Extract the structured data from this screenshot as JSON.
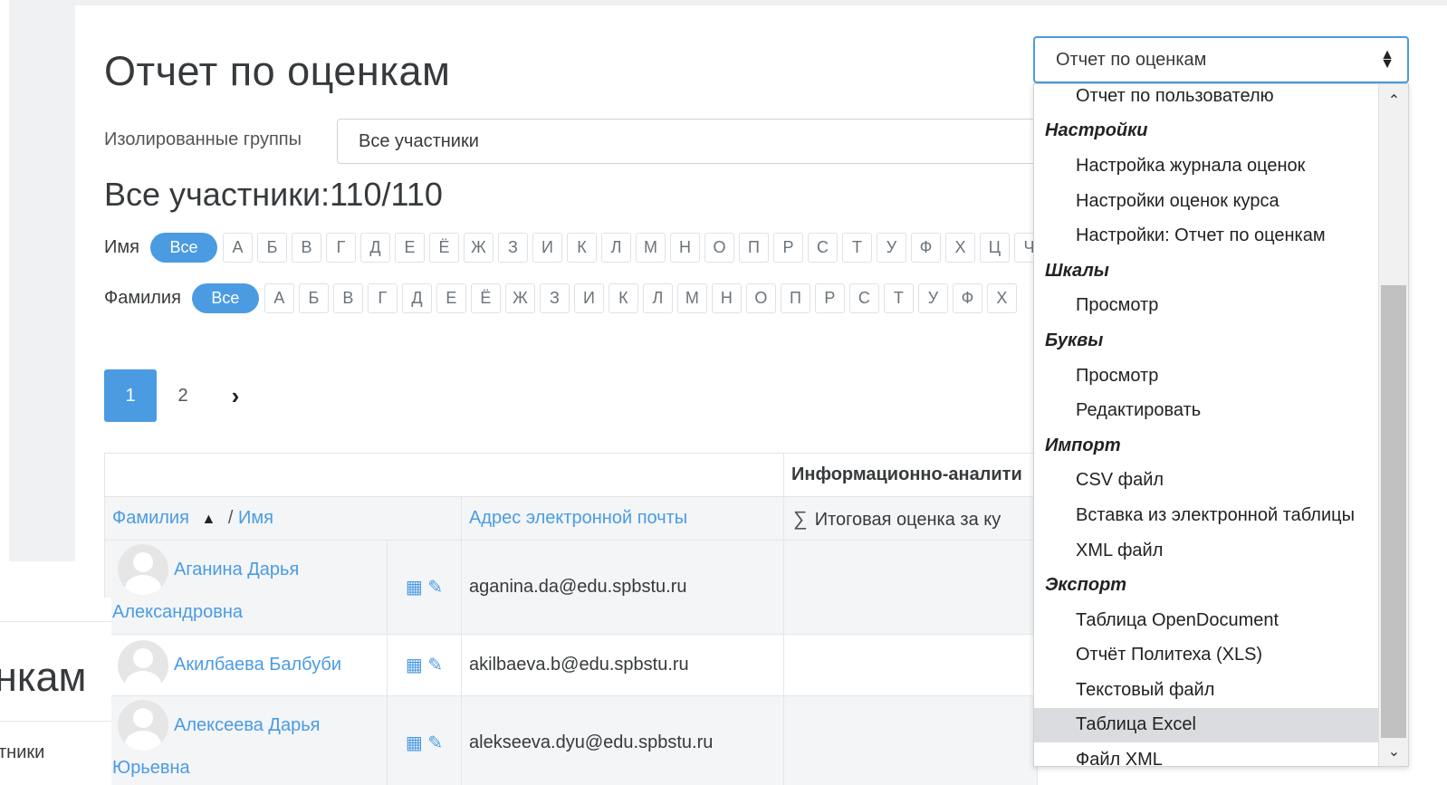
{
  "page": {
    "title": "Отчет по оценкам",
    "groups_label": "Изолированные группы",
    "groups_value": "Все участники",
    "participants": "Все участники:110/110"
  },
  "filters": {
    "first_name_label": "Имя",
    "last_name_label": "Фамилия",
    "all_label": "Все",
    "first_letters": [
      "А",
      "Б",
      "В",
      "Г",
      "Д",
      "Е",
      "Ё",
      "Ж",
      "З",
      "И",
      "К",
      "Л",
      "М",
      "Н",
      "О",
      "П",
      "Р",
      "С",
      "Т",
      "У",
      "Ф",
      "Х",
      "Ц",
      "Ч"
    ],
    "last_letters": [
      "А",
      "Б",
      "В",
      "Г",
      "Д",
      "Е",
      "Ё",
      "Ж",
      "З",
      "И",
      "К",
      "Л",
      "М",
      "Н",
      "О",
      "П",
      "Р",
      "С",
      "Т",
      "У",
      "Ф",
      "Х"
    ]
  },
  "pagination": {
    "pages": [
      "1",
      "2"
    ],
    "current": "1",
    "next": "›"
  },
  "table": {
    "category": "Информационно-аналити",
    "col_surname": "Фамилия",
    "col_sort_indicator": "▲",
    "col_separator": "/",
    "col_name": "Имя",
    "col_email": "Адрес электронной почты",
    "col_total": "Итоговая оценка за ку",
    "rows": [
      {
        "name_line1": "Аганина Дарья",
        "name_line2": "Александровна",
        "email": "aganina.da@edu.spbstu.ru"
      },
      {
        "name_line1": "Акилбаева Балбуби",
        "name_line2": "",
        "email": "akilbaeva.b@edu.spbstu.ru"
      },
      {
        "name_line1": "Алексеева Дарья",
        "name_line2": "Юрьевна",
        "email": "alekseeva.dyu@edu.spbstu.ru"
      }
    ]
  },
  "ghost": {
    "title": "нкам",
    "sub": "тники"
  },
  "report_select": {
    "value": "Отчет по оценкам",
    "options": [
      {
        "label": "Отчет по пользователю",
        "type": "item"
      },
      {
        "label": "Настройки",
        "type": "group"
      },
      {
        "label": "Настройка журнала оценок",
        "type": "item"
      },
      {
        "label": "Настройки оценок курса",
        "type": "item"
      },
      {
        "label": "Настройки: Отчет по оценкам",
        "type": "item"
      },
      {
        "label": "Шкалы",
        "type": "group"
      },
      {
        "label": "Просмотр",
        "type": "item"
      },
      {
        "label": "Буквы",
        "type": "group"
      },
      {
        "label": "Просмотр",
        "type": "item"
      },
      {
        "label": "Редактировать",
        "type": "item"
      },
      {
        "label": "Импорт",
        "type": "group"
      },
      {
        "label": "CSV файл",
        "type": "item"
      },
      {
        "label": "Вставка из электронной таблицы",
        "type": "item"
      },
      {
        "label": "XML файл",
        "type": "item"
      },
      {
        "label": "Экспорт",
        "type": "group"
      },
      {
        "label": "Таблица OpenDocument",
        "type": "item"
      },
      {
        "label": "Отчёт Политеха (XLS)",
        "type": "item"
      },
      {
        "label": "Текстовый файл",
        "type": "item"
      },
      {
        "label": "Таблица Excel",
        "type": "item",
        "selected": true
      },
      {
        "label": "Файл XML",
        "type": "item"
      }
    ]
  },
  "colors": {
    "accent": "#4b9be3",
    "text": "#373a3c",
    "muted_bg": "#f3f5f7"
  }
}
